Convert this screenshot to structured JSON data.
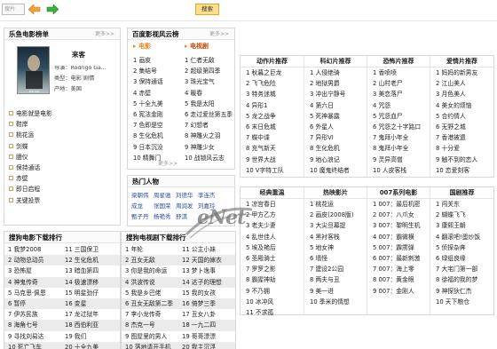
{
  "toolbar": {
    "search_value": "搜片",
    "search_button": "搜索"
  },
  "leyu_panel": {
    "title": "乐鱼电影榜单",
    "more": "更多>>",
    "movie": {
      "title": "来客",
      "director": "导演：Rodrigo Ga...",
      "type": "类型：电影 剧情",
      "region": "产地：美国"
    },
    "list": [
      "电影就是电影",
      "鞋岸",
      "桃花运",
      "剑蝶",
      "臆仪",
      "保持通话",
      "赤壁",
      "即日启程",
      "关键投票"
    ]
  },
  "baidu_panel": {
    "title": "百度影视风云榜",
    "more": "更多>>",
    "tab_movie": "电影",
    "tab_tv": "电视剧",
    "movies": [
      "1 画皮",
      "2 集结号",
      "3 保持通话",
      "4 赤壁",
      "5 十全九美",
      "6 宪法金刚",
      "7 色即是空",
      "8 生化危机",
      "9 日本沉没",
      "10 精舞门"
    ],
    "tv": [
      "1 仁者无敌",
      "2 超级第四季",
      "3 珠光宝气",
      "4 暖春",
      "5 我是太阳",
      "6 走过爱丝第五季",
      "7 幻想者",
      "8 神雕火之羽",
      "9 神雕少女",
      "10 战锁风云志"
    ],
    "more2": "更多>>"
  },
  "hot_people": {
    "title": "热门人物",
    "more": "更多>>",
    "rows": [
      [
        "梁朝伟",
        "周星驰",
        "刘德华",
        "李连杰"
      ],
      [
        "成龙",
        "张国荣",
        "周润发",
        "刘嘉玲"
      ],
      [
        "甄子丹",
        "杨艳秀",
        "舒淇"
      ]
    ]
  },
  "sogou_movie": {
    "title": "搜狗电影下载排行",
    "col1": [
      "1 我梦2008",
      "2 动物总动员",
      "3 恐怖屋",
      "4 神鬼传奇",
      "5 马克思·佩恩",
      "6 暂停",
      "7 伊苏民族",
      "8 海角七号",
      "9 寻找刘易达",
      "10 死亡飞车"
    ],
    "col2": [
      "11 三国保卫",
      "12 生化危机",
      "13 暗血第四",
      "14 极速漂移",
      "15 明星劲仔",
      "16 变星",
      "17 龙过狱年",
      "18 西伯利亚",
      "19 我们",
      "20 十全九美"
    ]
  },
  "sogou_tv": {
    "title": "搜狗电视剧下载排行",
    "col1": [
      "1 年轮",
      "2 丑女无敌",
      "3 你是我的命运",
      "4 洪波传说",
      "5 我是乡巴佬",
      "6 丑女无敌第二季",
      "7 李小龙传奇",
      "8 杰克一号",
      "9 图屋里的男人",
      "10 落地请开手机"
    ],
    "col2": [
      "11 公主小妹",
      "12 天国的嫁衣",
      "13 梦卜逸事",
      "14 达子的理想",
      "15 我的女孩",
      "16 倚梦三季",
      "17 丑女八卦",
      "18 一九二四",
      "19 哥哥漂漂",
      "20 我主沉浮"
    ]
  },
  "cat_row1": [
    {
      "title": "动作片推荐",
      "items": [
        "1 秋暮之巨龙",
        "2 飞飞危险",
        "3 特务迷城",
        "4 异形1",
        "5 龙之战争",
        "6 末日危城",
        "7 蝶中谍",
        "8 充气新天",
        "9 世界大战",
        "10 V字特工队"
      ]
    },
    {
      "title": "科幻片推荐",
      "items": [
        "1 人侵绝骑",
        "2 地狱男爵",
        "3 冲出宁静号",
        "4 第六日",
        "5 死神暴露",
        "6 外星人",
        "7 异形VI",
        "8 生化危机",
        "9 地心浪记",
        "10 魔鬼终结者"
      ]
    },
    {
      "title": "恐怖片推荐",
      "items": [
        "1 香喷喷",
        "2 山村老尸",
        "3 美恋落尸",
        "4 咒怨",
        "5 咒怨血尸",
        "6 咒怨之十字路口",
        "7 鬼拜小年全",
        "8 鬼拜小年全",
        "9 灵异高僧",
        "10 人皮客栈"
      ]
    },
    {
      "title": "爱情片推荐",
      "items": [
        "1 妈妈的新男友",
        "2 江山美人",
        "3 月色美人",
        "4 美女的烦恼",
        "5 合约情人",
        "6 无野之城",
        "7 香港被遗",
        "8 十分爱",
        "9 触不到的恋人",
        "10 恋爱刻客"
      ]
    }
  ],
  "cat_row2": [
    {
      "title": "经典重温",
      "items": [
        "1 凉宫春日",
        "2 甲方乙方",
        "3 老夫少妻",
        "4 乱世佳人",
        "5 埃及艳后",
        "6 圣殿骑士",
        "7 罗罗之影",
        "8 霸猩神劫",
        "9 不乃拥",
        "10 冰冲风",
        "11 不求孤"
      ]
    },
    {
      "title": "热映影片",
      "items": [
        "1 桃花运",
        "2 画皮(2008版)",
        "3 大尖旦幕提",
        "4 黑衬客栈",
        "5 地女神",
        "6 墙怪",
        "7 建设2公园",
        "8 两夫与丑",
        "9 美一进",
        "10 季米的情想"
      ]
    },
    {
      "title": "007系列电影",
      "items": [
        "1 007：最后机密",
        "2 007：八爪女",
        "3 007：黎明生机",
        "4 007：霸微横",
        "5 007：霹雳弹",
        "6 007：最新刺激",
        "7 007：海上零",
        "8 007：黄金眼",
        "9 007：金刚人"
      ]
    },
    {
      "title": "国剧推荐",
      "items": [
        "1 闯关东",
        "2 蝴蝶飞飞",
        "3 康熙王朝",
        "4 翻滚吧!蛋炒饭",
        "5 侦探杂奔",
        "6 绿组良缘",
        "7 大宅门第一部",
        "8 徐福的我的梦",
        "9 神探狄仁杰",
        "10 天下粮仓"
      ]
    }
  ],
  "watermark": "eNet"
}
